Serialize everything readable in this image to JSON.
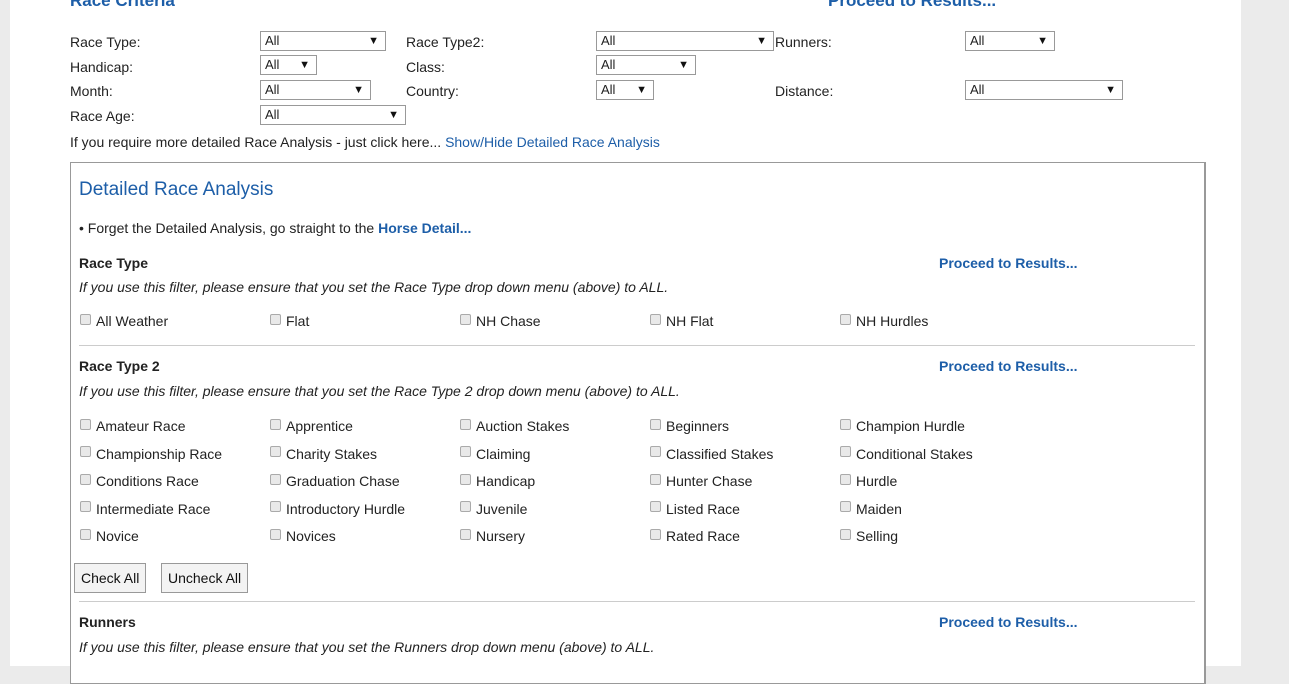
{
  "header": {
    "heading": "Race Criteria",
    "proceed_top": "Proceed to Results..."
  },
  "filters": {
    "race_type": {
      "label": "Race Type:",
      "value": "All"
    },
    "race_type2": {
      "label": "Race Type2:",
      "value": "All"
    },
    "runners": {
      "label": "Runners:",
      "value": "All"
    },
    "handicap": {
      "label": "Handicap:",
      "value": "All"
    },
    "class": {
      "label": "Class:",
      "value": "All"
    },
    "month": {
      "label": "Month:",
      "value": "All"
    },
    "country": {
      "label": "Country:",
      "value": "All"
    },
    "distance": {
      "label": "Distance:",
      "value": "All"
    },
    "race_age": {
      "label": "Race Age:",
      "value": "All"
    }
  },
  "info": {
    "text": "If you require more detailed Race Analysis - just click here...",
    "link": "Show/Hide Detailed Race Analysis"
  },
  "detail": {
    "title": "Detailed Race Analysis",
    "bullet_text": "• Forget the Detailed Analysis, go straight to the",
    "bullet_link": "Horse Detail...",
    "sections": {
      "race_type": {
        "title": "Race Type",
        "proceed": "Proceed to Results...",
        "note": "If you use this filter, please ensure that you set the Race Type drop down menu (above) to ALL.",
        "options": [
          "All Weather",
          "Flat",
          "NH Chase",
          "NH Flat",
          "NH Hurdles"
        ]
      },
      "race_type2": {
        "title": "Race Type 2",
        "proceed": "Proceed to Results...",
        "note": "If you use this filter, please ensure that you set the Race Type 2 drop down menu (above) to ALL.",
        "options": [
          "Amateur Race",
          "Apprentice",
          "Auction Stakes",
          "Beginners",
          "Champion Hurdle",
          "Championship Race",
          "Charity Stakes",
          "Claiming",
          "Classified Stakes",
          "Conditional Stakes",
          "Conditions Race",
          "Graduation Chase",
          "Handicap",
          "Hunter Chase",
          "Hurdle",
          "Intermediate Race",
          "Introductory Hurdle",
          "Juvenile",
          "Listed Race",
          "Maiden",
          "Novice",
          "Novices",
          "Nursery",
          "Rated Race",
          "Selling"
        ],
        "check_all": "Check All",
        "uncheck_all": "Uncheck All"
      },
      "runners": {
        "title": "Runners",
        "proceed": "Proceed to Results...",
        "note": "If you use this filter, please ensure that you set the Runners drop down menu (above) to ALL."
      }
    }
  },
  "icons": {
    "dropdown": "dropdown-arrow-icon",
    "checkbox": "checkbox-unchecked"
  }
}
